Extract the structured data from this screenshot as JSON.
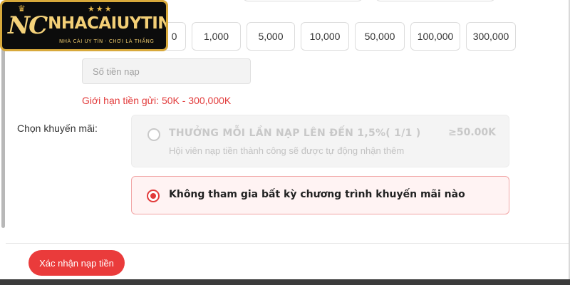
{
  "brand": {
    "logo_main": "NC",
    "logo_name": "NHACAIUYTIN",
    "logo_tagline": "NHÀ CÁI UY TÍN · CHƠI LÀ THẮNG",
    "stars": "★★★"
  },
  "amounts": {
    "partial_label": "0",
    "options": [
      "1,000",
      "5,000",
      "10,000",
      "50,000",
      "100,000",
      "300,000"
    ]
  },
  "amount_input": {
    "placeholder": "Số tiền nạp"
  },
  "deposit_limit": "Giới hạn tiền gửi:  50K  - 300,000K",
  "promotion": {
    "label": "Chọn khuyến mãi:",
    "offer": {
      "title": "THƯỞNG MỖI LẦN NẠP LÊN ĐẾN 1,5%( 1/1 )",
      "min_amount": "≥50.00K",
      "description": "Hội viên nạp tiền  thành công sẽ được tự động nhận thêm"
    },
    "none_option": "Không tham gia bất kỳ chương trình khuyến mãi nào",
    "selected": "none"
  },
  "confirm_button": "Xác nhận nạp tiền",
  "colors": {
    "accent": "#ea3b3b",
    "limit_text": "#e23b3b",
    "logo_gold": "#d8a93b"
  }
}
